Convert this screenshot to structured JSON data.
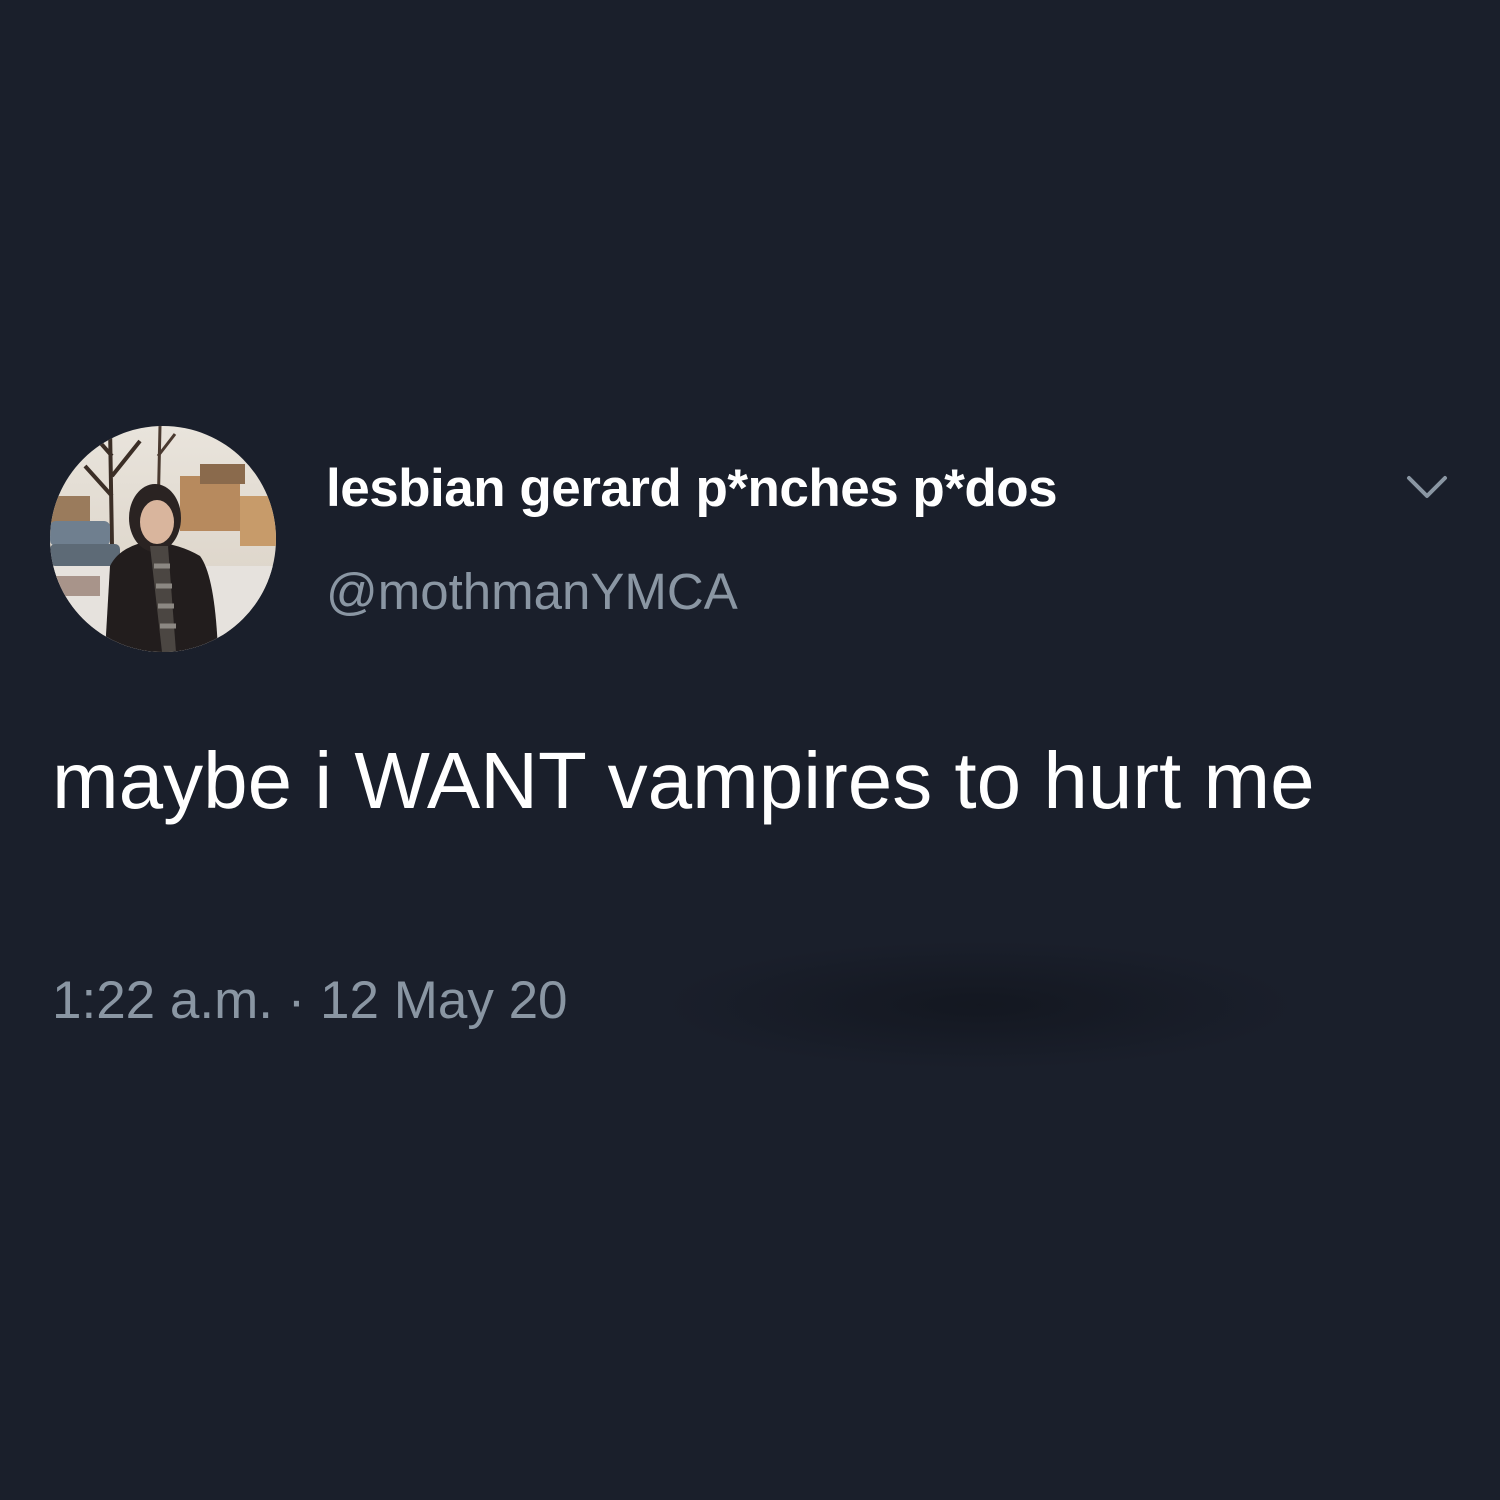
{
  "tweet": {
    "display_name": "lesbian gerard p*nches p*dos",
    "handle": "@mothmanYMCA",
    "text": "maybe i WANT vampires to hurt me",
    "timestamp": "1:22 a.m. · 12 May 20"
  },
  "icons": {
    "menu": "chevron-down-icon"
  },
  "colors": {
    "background": "#1a1f2b",
    "primary_text": "#ffffff",
    "secondary_text": "#8a96a3"
  }
}
